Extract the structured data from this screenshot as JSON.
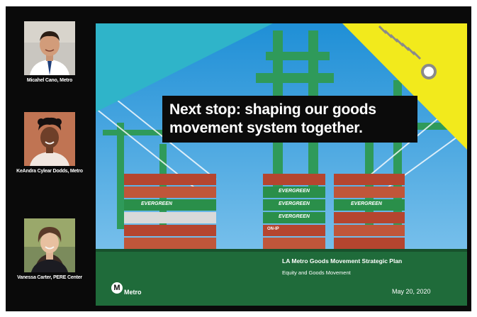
{
  "speakers": [
    {
      "name": "Micahel Cano, Metro"
    },
    {
      "name": "KeAndra Cylear Dodds, Metro"
    },
    {
      "name": "Vanessa Carter, PERE Center"
    }
  ],
  "slide": {
    "headline_line1": "Next stop: shaping our goods",
    "headline_line2": "movement system together.",
    "container_label": "EVERGREEN",
    "container_label_short": "ON-IP",
    "plan_title": "LA Metro Goods Movement Strategic Plan",
    "plan_subtitle": "Equity and Goods Movement",
    "date": "May 20, 2020",
    "logo_letter": "M",
    "logo_text": "Metro"
  },
  "colors": {
    "teal_band": "#2fb4c9",
    "yellow_band": "#f2ea1c",
    "container_green": "#2a8f4a",
    "container_red": "#b5452f",
    "hull_green": "#1f6b3a",
    "crane_green": "#2f9a5a"
  }
}
